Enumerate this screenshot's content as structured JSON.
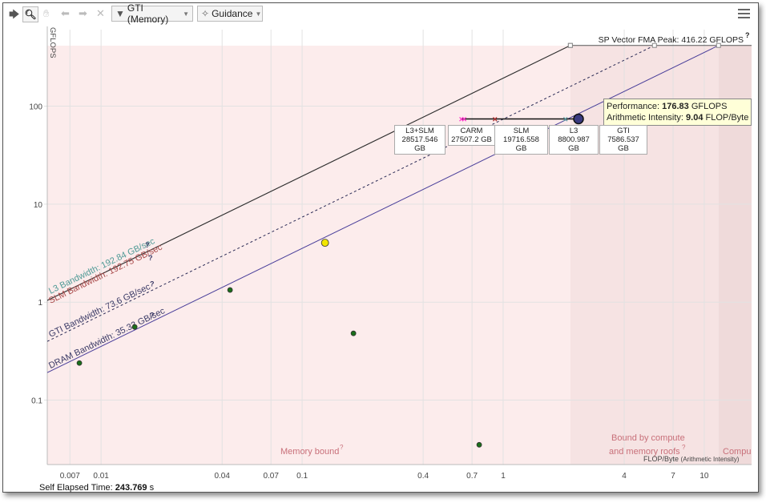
{
  "toolbar": {
    "select_icon": "arrow-cursor-icon",
    "zoom_icon": "magnifier-icon",
    "pan_icon": "hand-icon",
    "undo_icon": "undo-icon",
    "redo_icon": "redo-icon",
    "clear_icon": "close-icon",
    "filter_label": "GTI (Memory)",
    "guidance_label": "Guidance",
    "menu_icon": "hamburger-icon"
  },
  "tooltip": {
    "perf_label": "Performance:",
    "perf_value": "176.83",
    "perf_unit": "GFLOPS",
    "ai_label": "Arithmetic Intensity:",
    "ai_value": "9.04",
    "ai_unit": "FLOP/Byte"
  },
  "memory_levels": [
    {
      "name": "L3+SLM",
      "traffic": "28517.546 GB"
    },
    {
      "name": "CARM",
      "traffic": "27507.2 GB"
    },
    {
      "name": "SLM",
      "traffic": "19716.558 GB"
    },
    {
      "name": "L3",
      "traffic": "8800.987 GB"
    },
    {
      "name": "GTI",
      "traffic": "7586.537 GB"
    }
  ],
  "status": {
    "elapsed_label": "Self Elapsed Time:",
    "elapsed_value": "243.769",
    "elapsed_unit": "s"
  },
  "chart_data": {
    "type": "scatter",
    "title": "",
    "xlabel": "FLOP/Byte",
    "xlabel_sub": "(Arithmetic Intensity)",
    "ylabel": "GFLOPS",
    "xscale": "log",
    "yscale": "log",
    "xlim": [
      0.0054,
      17.2
    ],
    "ylim": [
      0.022,
      414
    ],
    "xticks": [
      0.007,
      0.01,
      0.04,
      0.07,
      0.1,
      0.4,
      0.7,
      1,
      4,
      7,
      10
    ],
    "xtick_labels": [
      "0.007",
      "0.01",
      "0.04",
      "0.07",
      "0.1",
      "0.4",
      "0.7",
      "1",
      "4",
      "7",
      "10"
    ],
    "yticks": [
      100,
      10,
      1,
      0.1
    ],
    "ytick_labels": [
      "100",
      "10",
      "1",
      "0.1"
    ],
    "help_mark": "?",
    "compute_roof": {
      "label": "SP Vector FMA Peak: 416.22 GFLOPS",
      "value": 416.22
    },
    "memory_roofs": [
      {
        "name": "L3",
        "label": "L3 Bandwidth: 192.84 GB/sec",
        "bandwidth": 192.84,
        "color": "#4f9a96",
        "line": "#333333",
        "dash": ""
      },
      {
        "name": "SLM",
        "label": "SLM Bandwidth: 192.75 GB/sec",
        "bandwidth": 192.75,
        "color": "#a84848",
        "line": "#333333",
        "dash": ""
      },
      {
        "name": "GTI",
        "label": "GTI Bandwidth: 73.6 GB/sec",
        "bandwidth": 73.6,
        "color": "#3a3a66",
        "line": "#2a2a55",
        "dash": "3,3"
      },
      {
        "name": "DRAM",
        "label": "DRAM Bandwidth: 35.33 GB/sec",
        "bandwidth": 35.33,
        "color": "#3a3a66",
        "line": "#4a3f9a",
        "dash": ""
      }
    ],
    "regions": [
      {
        "label": "Memory bound",
        "color": "#fcecec"
      },
      {
        "label": "Bound by compute",
        "label2": "and memory roofs",
        "color": "#f6e3e3"
      },
      {
        "label": "Compu",
        "color": "#efdada"
      }
    ],
    "points": [
      {
        "x": 0.0078,
        "y": 0.239,
        "color": "#1a6e1a",
        "size": "small"
      },
      {
        "x": 0.0147,
        "y": 0.558,
        "color": "#1a6e1a",
        "size": "small"
      },
      {
        "x": 0.0438,
        "y": 1.33,
        "color": "#1a6e1a",
        "size": "small"
      },
      {
        "x": 0.13,
        "y": 4.03,
        "color": "#f2e600",
        "size": "medium"
      },
      {
        "x": 0.18,
        "y": 0.48,
        "color": "#1a6e1a",
        "size": "small"
      },
      {
        "x": 0.76,
        "y": 0.035,
        "color": "#1a6e1a",
        "size": "small"
      }
    ],
    "selected_trace": {
      "y": 74,
      "markers": [
        {
          "level": "L3+SLM",
          "x": 0.62,
          "color": "#ff33cc"
        },
        {
          "level": "CARM",
          "x": 0.64,
          "color": "#ff33cc"
        },
        {
          "level": "SLM",
          "x": 0.91,
          "color": "#b03030"
        },
        {
          "level": "L3",
          "x": 2.04,
          "color": "#5a9aa0"
        },
        {
          "level": "GTI",
          "x": 2.37,
          "color": "#3a3a80"
        }
      ]
    }
  }
}
